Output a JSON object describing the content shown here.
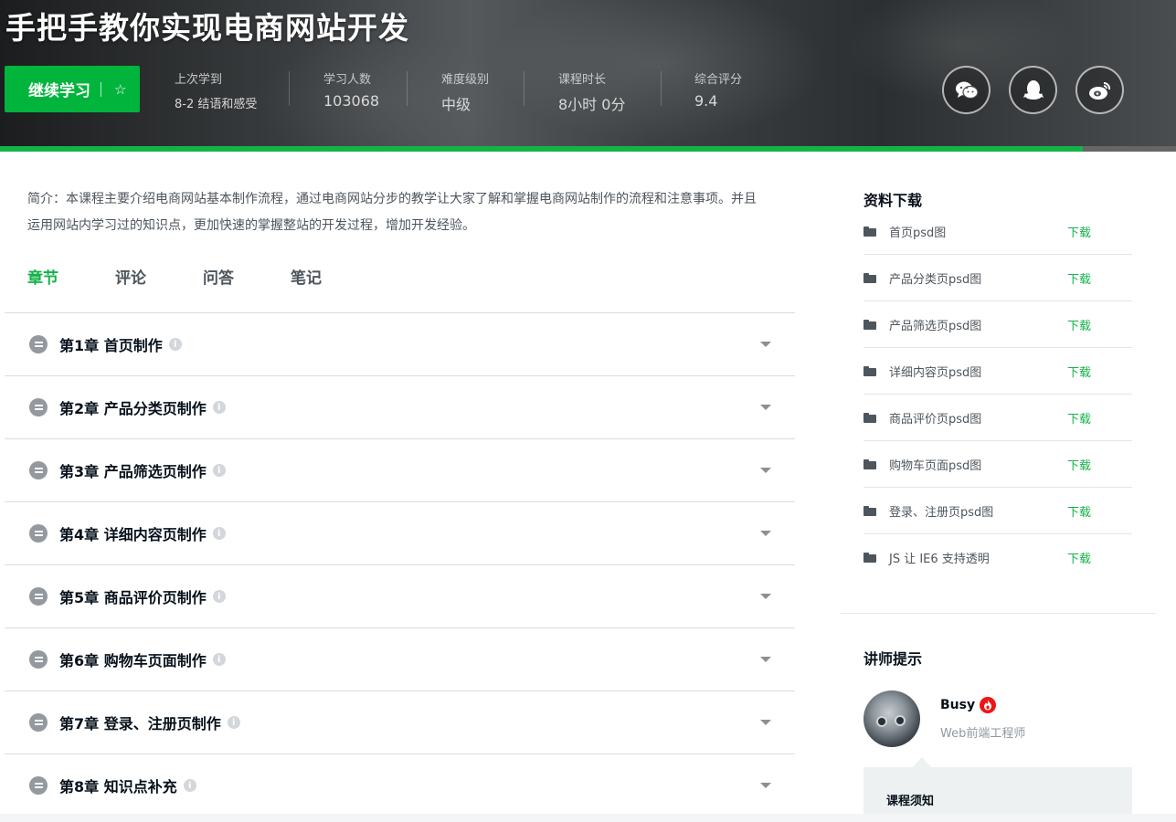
{
  "course": {
    "title": "手把手教你实现电商网站开发",
    "continue_label": "继续学习",
    "favorite_icon": "star-icon",
    "progress": 0.921
  },
  "stats": [
    {
      "key": "上次学到",
      "value": "8-2 结语和感受"
    },
    {
      "key": "学习人数",
      "value": "103068"
    },
    {
      "key": "难度级别",
      "value": "中级"
    },
    {
      "key": "课程时长",
      "value": "8小时 0分"
    },
    {
      "key": "综合评分",
      "value": "9.4"
    }
  ],
  "share": {
    "icons": [
      "wechat-icon",
      "qq-icon",
      "weibo-icon"
    ]
  },
  "intro": "简介：本课程主要介绍电商网站基本制作流程，通过电商网站分步的教学让大家了解和掌握电商网站制作的流程和注意事项。并且运用网站内学习过的知识点，更加快速的掌握整站的开发过程，增加开发经验。",
  "tabs": [
    {
      "label": "章节",
      "active": true
    },
    {
      "label": "评论",
      "active": false
    },
    {
      "label": "问答",
      "active": false
    },
    {
      "label": "笔记",
      "active": false
    }
  ],
  "chapters": [
    "第1章 首页制作",
    "第2章 产品分类页制作",
    "第3章 产品筛选页制作",
    "第4章 详细内容页制作",
    "第5章 商品评价页制作",
    "第6章 购物车页面制作",
    "第7章 登录、注册页制作",
    "第8章 知识点补充"
  ],
  "downloads": {
    "title": "资料下载",
    "link_label": "下载",
    "items": [
      "首页psd图",
      "产品分类页psd图",
      "产品筛选页psd图",
      "详细内容页psd图",
      "商品评价页psd图",
      "购物车页面psd图",
      "登录、注册页psd图",
      "JS 让 IE6 支持透明"
    ]
  },
  "teacher": {
    "section_title": "讲师提示",
    "name": "Busy",
    "job": "Web前端工程师",
    "notice_title": "课程须知"
  },
  "colors": {
    "accent": "#14b34a",
    "button": "#00b43c",
    "badge": "#f01414"
  }
}
